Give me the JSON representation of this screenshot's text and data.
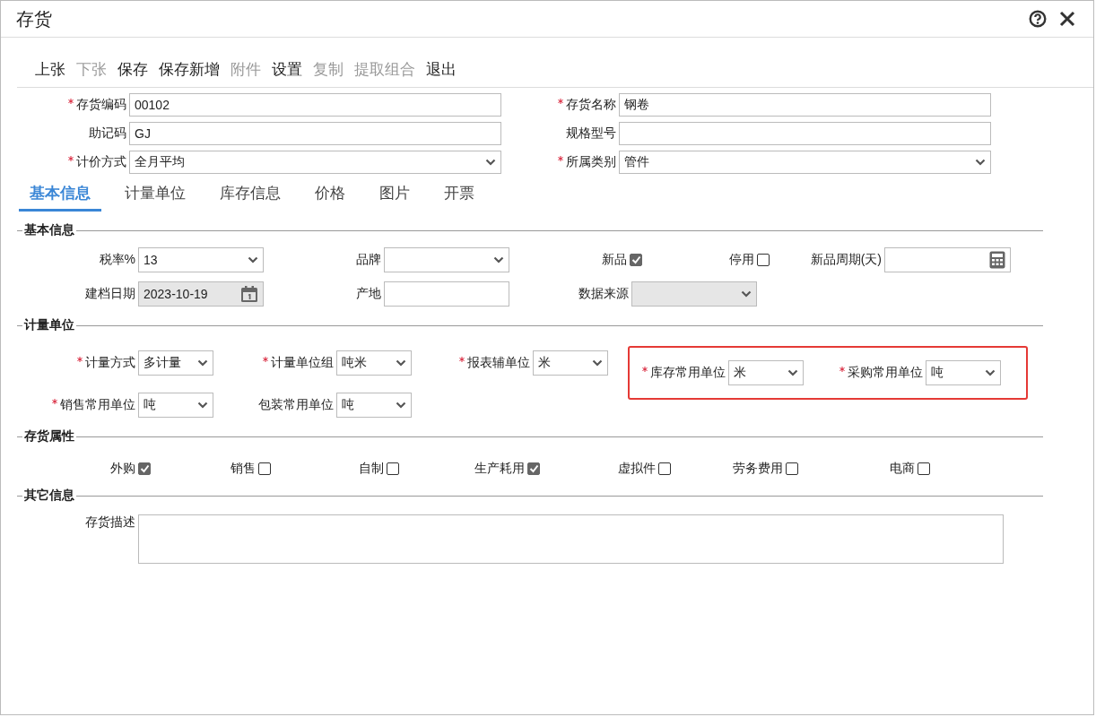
{
  "window": {
    "title": "存货"
  },
  "toolbar": [
    {
      "label": "上张",
      "disabled": false
    },
    {
      "label": "下张",
      "disabled": true
    },
    {
      "label": "保存",
      "disabled": false
    },
    {
      "label": "保存新增",
      "disabled": false
    },
    {
      "label": "附件",
      "disabled": true
    },
    {
      "label": "设置",
      "disabled": false
    },
    {
      "label": "复制",
      "disabled": true
    },
    {
      "label": "提取组合",
      "disabled": true
    },
    {
      "label": "退出",
      "disabled": false
    }
  ],
  "header": {
    "rows": [
      [
        {
          "label": "存货编码",
          "required": true,
          "kind": "text",
          "value": "00102"
        },
        {
          "label": "存货名称",
          "required": true,
          "kind": "text",
          "value": "钢卷"
        }
      ],
      [
        {
          "label": "助记码",
          "required": false,
          "kind": "text",
          "value": "GJ"
        },
        {
          "label": "规格型号",
          "required": false,
          "kind": "text"
        }
      ],
      [
        {
          "label": "计价方式",
          "required": true,
          "kind": "select",
          "value": "全月平均"
        },
        {
          "label": "所属类别",
          "required": true,
          "kind": "select",
          "value": "管件"
        }
      ]
    ]
  },
  "tabs": [
    {
      "label": "基本信息",
      "selected": true
    },
    {
      "label": "计量单位",
      "selected": false
    },
    {
      "label": "库存信息",
      "selected": false
    },
    {
      "label": "价格",
      "selected": false
    },
    {
      "label": "图片",
      "selected": false
    },
    {
      "label": "开票",
      "selected": false
    }
  ],
  "basic_info": {
    "title": "基本信息",
    "rows": [
      [
        {
          "label": "税率%",
          "required": false,
          "kind": "select",
          "value": "13"
        },
        {
          "label": "品牌",
          "required": false,
          "kind": "select"
        },
        {
          "label": "新品",
          "required": false,
          "kind": "checkbox",
          "checked": true
        },
        {
          "label": "停用",
          "required": false,
          "kind": "checkbox",
          "checked": false
        },
        {
          "label": "新品周期(天)",
          "required": false,
          "kind": "number"
        }
      ],
      [
        {
          "label": "建档日期",
          "required": false,
          "kind": "date",
          "value": "2023-10-19"
        },
        {
          "label": "产地",
          "required": false,
          "kind": "text"
        },
        {
          "label": "数据来源",
          "required": false,
          "kind": "select",
          "disabled": true
        }
      ]
    ]
  },
  "measurement_units": {
    "title": "计量单位",
    "rows": [
      {
        "items": [
          {
            "label": "计量方式",
            "required": true,
            "kind": "select",
            "value": "多计量"
          },
          {
            "label": "计量单位组",
            "required": true,
            "kind": "select",
            "value": "吨米"
          },
          {
            "label": "报表辅单位",
            "required": true,
            "kind": "select",
            "value": "米"
          }
        ],
        "highlighted": [
          {
            "label": "库存常用单位",
            "required": true,
            "kind": "select",
            "value": "米"
          },
          {
            "label": "采购常用单位",
            "required": true,
            "kind": "select",
            "value": "吨"
          }
        ]
      },
      {
        "items": [
          {
            "label": "销售常用单位",
            "required": true,
            "kind": "select",
            "value": "吨"
          },
          {
            "label": "包装常用单位",
            "required": false,
            "kind": "select",
            "value": "吨"
          }
        ]
      }
    ]
  },
  "attributes": {
    "title": "存货属性",
    "items": [
      {
        "label": "外购",
        "checked": true
      },
      {
        "label": "销售",
        "checked": false
      },
      {
        "label": "自制",
        "checked": false
      },
      {
        "label": "生产耗用",
        "checked": true
      },
      {
        "label": "虚拟件",
        "checked": false
      },
      {
        "label": "劳务费用",
        "checked": false
      },
      {
        "label": "电商",
        "checked": false
      }
    ]
  },
  "other_info": {
    "title": "其它信息",
    "description": {
      "label": "存货描述"
    }
  }
}
